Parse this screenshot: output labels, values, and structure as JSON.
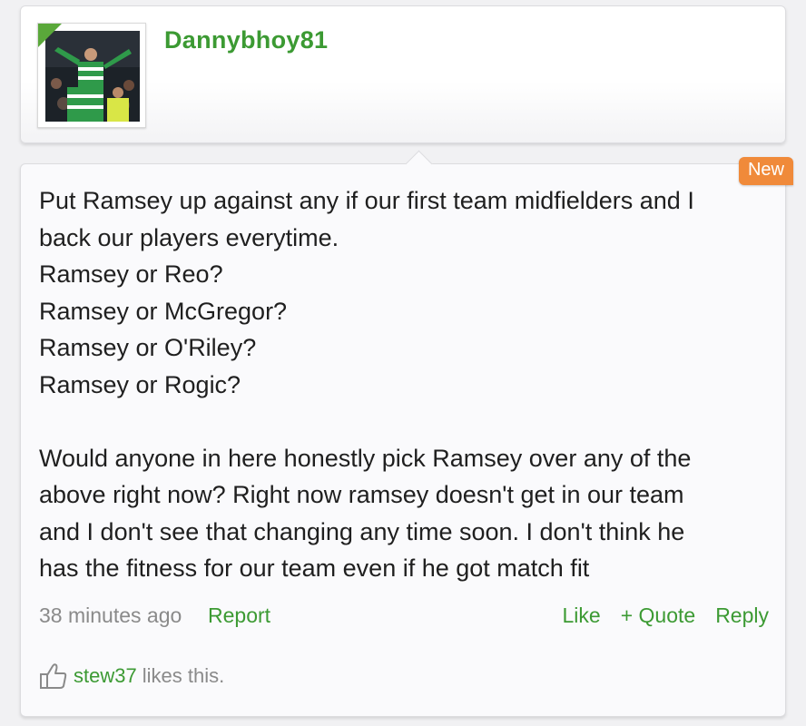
{
  "author": {
    "username": "Dannybhoy81",
    "avatar_icon": "user-avatar-photo"
  },
  "post": {
    "badge": "New",
    "body": "Put Ramsey up against any if our first team midfielders and I\nback our players everytime.\nRamsey or Reo?\nRamsey or McGregor?\nRamsey or O'Riley?\nRamsey or Rogic?\n\nWould anyone in here honestly pick Ramsey over any of the\nabove right now? Right now ramsey doesn't get in our team\nand I don't see that changing any time soon. I don't think he\nhas the fitness for our team even if he got match fit",
    "timestamp": "38 minutes ago",
    "report_label": "Report",
    "like_label": "Like",
    "quote_label": "+ Quote",
    "reply_label": "Reply"
  },
  "likes": {
    "user": "stew37",
    "suffix": "likes this."
  },
  "colors": {
    "accent_green": "#3c9a33",
    "badge_orange": "#f08a3a"
  }
}
